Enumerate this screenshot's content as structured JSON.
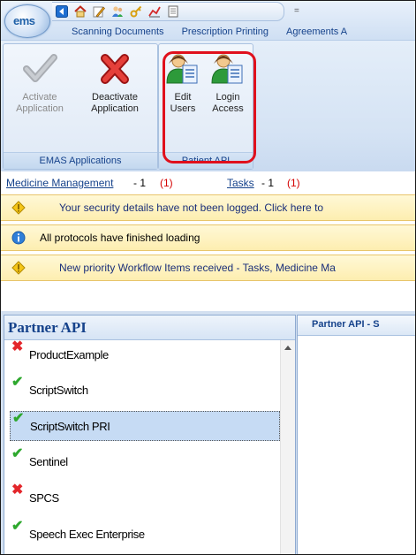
{
  "app": {
    "logo_text": "ems"
  },
  "quick_access": {
    "icons": [
      "nav-back-icon",
      "home-icon",
      "edit-icon",
      "users-icon",
      "key-icon",
      "chart-icon",
      "document-icon"
    ],
    "separator": "="
  },
  "ribbon_tabs": [
    "Scanning Documents",
    "Prescription Printing",
    "Agreements A"
  ],
  "ribbon": {
    "groups": [
      {
        "title": "EMAS Applications",
        "buttons": [
          {
            "label": "Activate\nApplication",
            "enabled": false,
            "icon": "checkmark-icon"
          },
          {
            "label": "Deactivate\nApplication",
            "enabled": true,
            "icon": "red-x-icon"
          }
        ]
      },
      {
        "title": "Patient API",
        "buttons": [
          {
            "label": "Edit\nUsers",
            "enabled": true,
            "icon": "user-document-icon"
          },
          {
            "label": "Login\nAccess",
            "enabled": true,
            "icon": "user-document-icon"
          }
        ]
      }
    ],
    "highlight_color": "#e0101c"
  },
  "links": {
    "medicine": {
      "label": "Medicine Management",
      "count": "- 1",
      "alert": "(1)"
    },
    "tasks": {
      "label": "Tasks",
      "count": "- 1",
      "alert": "(1)"
    }
  },
  "notifications": [
    {
      "type": "warning",
      "text": "Your security details have not been logged.  Click here to"
    },
    {
      "type": "info",
      "text": "All protocols have finished loading"
    },
    {
      "type": "warning",
      "text": "New priority Workflow Items received - Tasks, Medicine Ma"
    }
  ],
  "left_pane": {
    "title": "Partner API",
    "items": [
      {
        "name": "ProductExample",
        "status": "error",
        "selected": false
      },
      {
        "name": "ScriptSwitch",
        "status": "ok",
        "selected": false
      },
      {
        "name": "ScriptSwitch PRI",
        "status": "ok",
        "selected": true
      },
      {
        "name": "Sentinel",
        "status": "ok",
        "selected": false
      },
      {
        "name": "SPCS",
        "status": "error",
        "selected": false
      },
      {
        "name": "Speech Exec Enterprise",
        "status": "ok",
        "selected": false
      }
    ]
  },
  "right_pane": {
    "title": "Partner API - S"
  },
  "colors": {
    "accent": "#15428b",
    "ok": "#2ea82e",
    "error": "#e3262b",
    "alert_red": "#d40000"
  }
}
